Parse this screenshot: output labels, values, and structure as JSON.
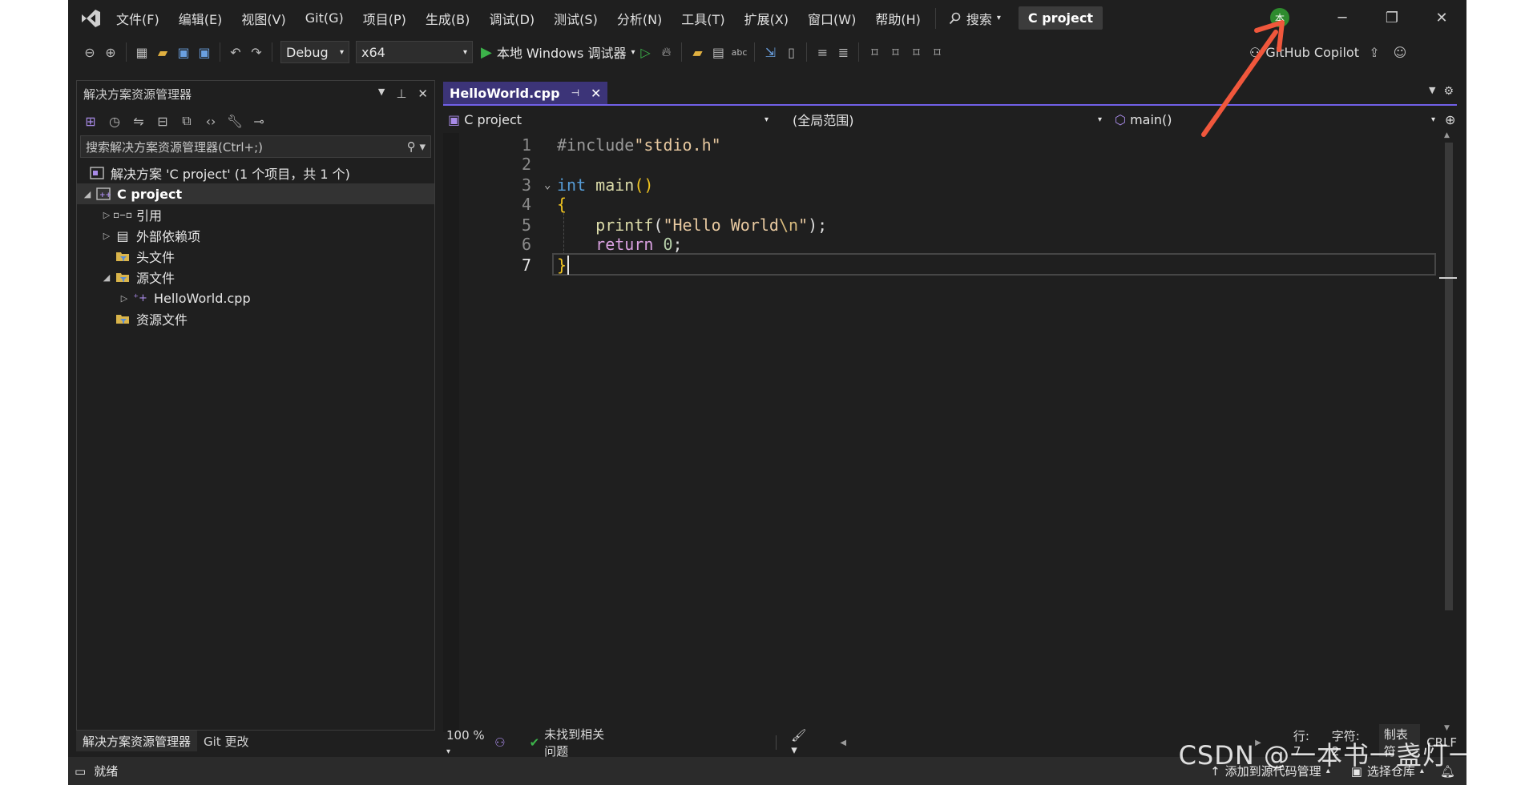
{
  "menu": {
    "items": [
      "文件(F)",
      "编辑(E)",
      "视图(V)",
      "Git(G)",
      "项目(P)",
      "生成(B)",
      "调试(D)",
      "测试(S)",
      "分析(N)",
      "工具(T)",
      "扩展(X)",
      "窗口(W)",
      "帮助(H)"
    ],
    "search_label": "搜索",
    "project_name": "C project"
  },
  "account": {
    "avatar_text": "本"
  },
  "toolbar": {
    "config": "Debug",
    "platform": "x64",
    "run_label": "本地 Windows 调试器",
    "copilot_label": "GitHub Copilot"
  },
  "solution_explorer": {
    "title": "解决方案资源管理器",
    "search_placeholder": "搜索解决方案资源管理器(Ctrl+;)",
    "tree": {
      "solution": "解决方案 'C project' (1 个项目，共 1 个)",
      "project": "C project",
      "references": "引用",
      "external_deps": "外部依赖项",
      "header_files": "头文件",
      "source_files": "源文件",
      "source_file": "HelloWorld.cpp",
      "resource_files": "资源文件"
    },
    "bottom_tabs": [
      "解决方案资源管理器",
      "Git 更改"
    ]
  },
  "editor": {
    "tab_name": "HelloWorld.cpp",
    "nav_project": "C project",
    "nav_scope": "(全局范围)",
    "nav_member": "main()",
    "lines": [
      {
        "num": "1",
        "text": "#include\"stdio.h\""
      },
      {
        "num": "2",
        "text": ""
      },
      {
        "num": "3",
        "text": "int main()"
      },
      {
        "num": "4",
        "text": "{"
      },
      {
        "num": "5",
        "text": "    printf(\"Hello World\\n\");"
      },
      {
        "num": "6",
        "text": "    return 0;"
      },
      {
        "num": "7",
        "text": "}"
      }
    ],
    "current_line": 7,
    "zoom": "100 %",
    "issues": "未找到相关问题",
    "line_info": "行: 7",
    "char_info": "字符: 2",
    "indent": "制表符",
    "eol": "CRLF"
  },
  "statusbar": {
    "ready": "就绪",
    "add_source": "添加到源代码管理",
    "select_repo": "选择仓库"
  },
  "watermark": "CSDN @一本书一盏灯一只笔",
  "colors": {
    "accent": "#7160e8",
    "avatar": "#2e8b2e",
    "annotation_arrow": "#f0573c"
  }
}
